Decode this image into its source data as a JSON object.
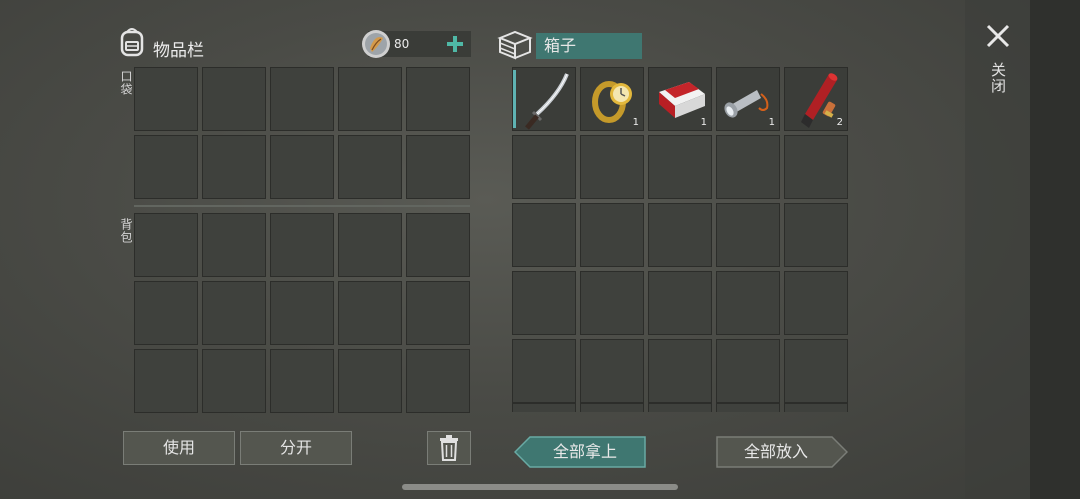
{
  "inventory": {
    "title": "物品栏",
    "coins": "80",
    "pocket_label": "口袋",
    "backpack_label": "背包"
  },
  "box": {
    "title": "箱子"
  },
  "items": [
    {
      "name": "katana",
      "count": ""
    },
    {
      "name": "gold-watch",
      "count": "1"
    },
    {
      "name": "cigarette-pack",
      "count": "1"
    },
    {
      "name": "flashlight",
      "count": "1"
    },
    {
      "name": "flare-and-shells",
      "count": "2"
    }
  ],
  "buttons": {
    "use": "使用",
    "split": "分开",
    "take_all": "全部拿上",
    "put_all": "全部放入"
  },
  "close_label": "关闭",
  "colors": {
    "accent": "#3f7771",
    "plus": "#4fb8a6"
  }
}
